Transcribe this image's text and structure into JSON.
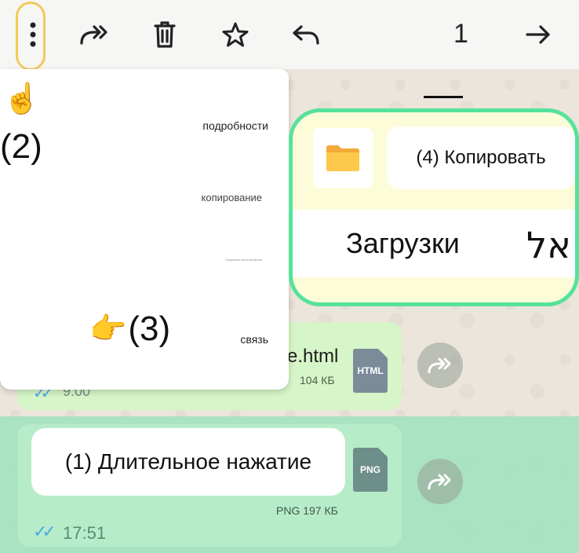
{
  "toolbar": {
    "selected_count": "1",
    "icons": [
      "more-vert-icon",
      "forward-all-icon",
      "delete-icon",
      "star-icon",
      "reply-icon",
      "forward-icon"
    ]
  },
  "menu": {
    "items": [
      "подробности",
      "копирование",
      "Сохранить на устройство",
      "связь"
    ]
  },
  "annotations": {
    "step1": "(1) Длительное нажатие",
    "step2": "(2)",
    "step3": "(3)",
    "step4": "(4) Копировать",
    "pointer_up": "☝️",
    "pointer_right": "👉"
  },
  "dialog": {
    "folder_label": "Загрузки",
    "hebrew_text": "אל"
  },
  "messages": [
    {
      "filename": "e.html",
      "file_type": "HTML",
      "size": "104 КБ",
      "time": "9:00",
      "ticks": "✓✓"
    },
    {
      "file_type": "PNG",
      "size": "PNG 197 КБ",
      "time": "17:51",
      "ticks": "✓✓"
    }
  ],
  "colors": {
    "highlight_ring": "#f2c95c",
    "dialog_border": "#56e29a",
    "selected_band": "#9fe3bd",
    "read_ticks": "#4fa7e4"
  }
}
